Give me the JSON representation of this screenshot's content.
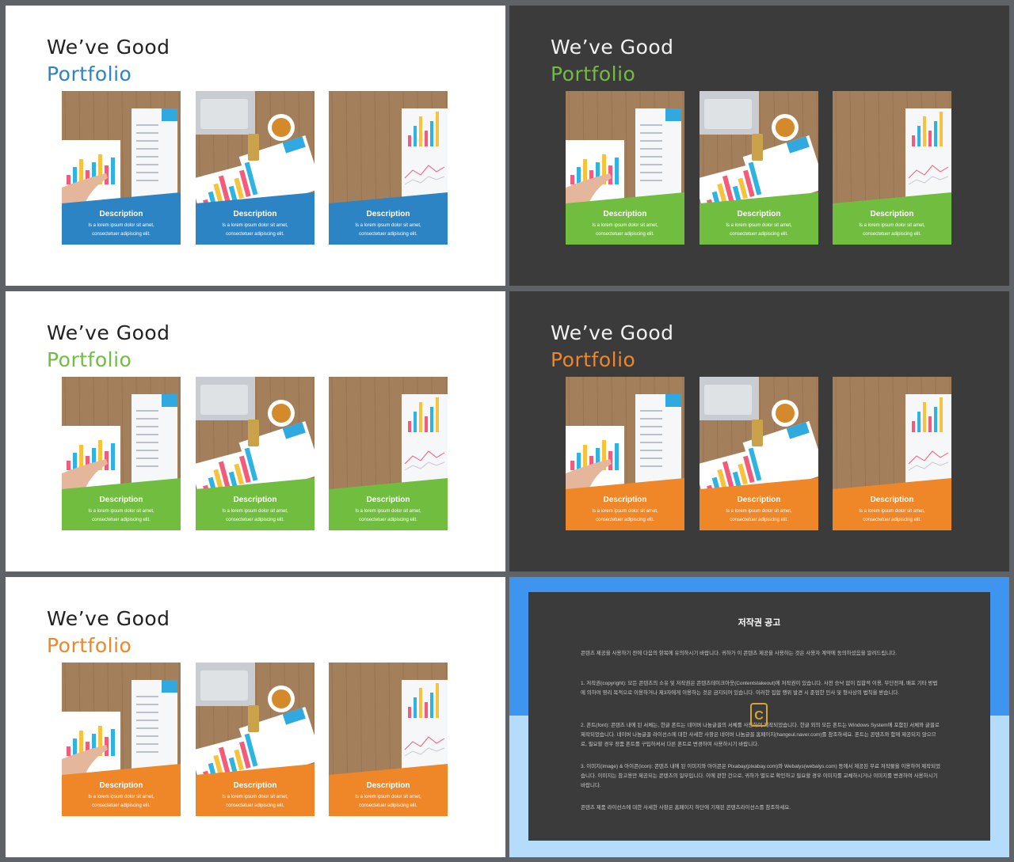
{
  "colors": {
    "blue": "#2d84c4",
    "green": "#71bd3f",
    "orange": "#ef8628",
    "dark_bg": "#3b3b3b",
    "notice_blue": "#3d95f0",
    "notice_light_blue": "#b6dcfb"
  },
  "slides": [
    {
      "theme": "light",
      "accent": "#2d84c4",
      "line1": "We’ve Good",
      "line2": "Portfolio",
      "cards": [
        {
          "title": "Description",
          "body1": "Is a lorem ipsum dolor sit amet,",
          "body2": "consectetuer adipiscing elit."
        },
        {
          "title": "Description",
          "body1": "Is a lorem ipsum dolor sit amet,",
          "body2": "consectetuer adipiscing elit."
        },
        {
          "title": "Description",
          "body1": "Is a lorem ipsum dolor sit amet,",
          "body2": "consectetuer adipiscing elit."
        }
      ]
    },
    {
      "theme": "dark",
      "accent": "#71bd3f",
      "line1": "We’ve Good",
      "line2": "Portfolio",
      "cards": [
        {
          "title": "Description",
          "body1": "Is a lorem ipsum dolor sit amet,",
          "body2": "consectetuer adipiscing elit."
        },
        {
          "title": "Description",
          "body1": "Is a lorem ipsum dolor sit amet,",
          "body2": "consectetuer adipiscing elit."
        },
        {
          "title": "Description",
          "body1": "Is a lorem ipsum dolor sit amet,",
          "body2": "consectetuer adipiscing elit."
        }
      ]
    },
    {
      "theme": "light",
      "accent": "#71bd3f",
      "line1": "We’ve Good",
      "line2": "Portfolio",
      "cards": [
        {
          "title": "Description",
          "body1": "Is a lorem ipsum dolor sit amet,",
          "body2": "consectetuer adipiscing elit."
        },
        {
          "title": "Description",
          "body1": "Is a lorem ipsum dolor sit amet,",
          "body2": "consectetuer adipiscing elit."
        },
        {
          "title": "Description",
          "body1": "Is a lorem ipsum dolor sit amet,",
          "body2": "consectetuer adipiscing elit."
        }
      ]
    },
    {
      "theme": "dark",
      "accent": "#ef8628",
      "line1": "We’ve Good",
      "line2": "Portfolio",
      "cards": [
        {
          "title": "Description",
          "body1": "Is a lorem ipsum dolor sit amet,",
          "body2": "consectetuer adipiscing elit."
        },
        {
          "title": "Description",
          "body1": "Is a lorem ipsum dolor sit amet,",
          "body2": "consectetuer adipiscing elit."
        },
        {
          "title": "Description",
          "body1": "Is a lorem ipsum dolor sit amet,",
          "body2": "consectetuer adipiscing elit."
        }
      ]
    },
    {
      "theme": "light",
      "accent": "#ef8628",
      "line1": "We’ve Good",
      "line2": "Portfolio",
      "cards": [
        {
          "title": "Description",
          "body1": "Is a lorem ipsum dolor sit amet,",
          "body2": "consectetuer adipiscing elit."
        },
        {
          "title": "Description",
          "body1": "Is a lorem ipsum dolor sit amet,",
          "body2": "consectetuer adipiscing elit."
        },
        {
          "title": "Description",
          "body1": "Is a lorem ipsum dolor sit amet,",
          "body2": "consectetuer adipiscing elit."
        }
      ]
    }
  ],
  "notice": {
    "title": "저작권 공고",
    "para0": "콘텐츠 제공을 사용하기 전에 다음의 항목에 유의하시기 바랍니다. 귀하가 이 콘텐츠 제공을 사용하는 것은 사용자 계약에 동의하셨음을 알려드립니다.",
    "para1": "1. 저작권(copyright): 모든 콘텐츠의 소유 및 저작권은 콘텐츠테이크아웃(Contentstakeout)에 저작권이 있습니다. 사전 승낙 없이 집합적 이용, 무단전재, 배포 기타 방법에 의하여 영리 목적으로 이용하거나 제3자에게 이용하는 것은 금지되어 있습니다. 이러한 집합 행위 발견 시 준엄한 민사 및 형사상의 법칙을 받습니다.",
    "para2": "2. 폰트(font): 콘텐츠 내에 된 서체는, 한글 폰트는 네이버 나눔글꼴의 서체를 사용하여 제작되었습니다. 한글 외의 모든 폰트는 Windows System에 포함된 서체와 글꼴로 제작되었습니다. 네이버 나눔글꼴 라이선스에 대한 사세한 사항은 네이버 나눔글꼴 홈페이지(hangeul.naver.com)를 참조하세요. 폰트는 콘텐츠와 함께 제공되지 않으므로, 필요할 경우 정품 폰트를 구입하셔서 다른 폰트로 변경하여 사용하시기 바랍니다.",
    "para3": "3. 이미지(image) & 아이콘(icon): 콘텐츠 내에 된 이미지와 아이콘은 Pixabay(pixabay.com)와 Webalys(webalys.com) 등에서 제공된 무료 저작물을 이용하여 제작되었습니다. 이미지는 참고용만 제공되는 콘텐츠의 일부입니다. 이에 관한 건으로, 귀하가 별도로 확인하고 필요할 경우 이미지를 교체하시거나 이미지를 변경하여 사용하시기 바랍니다.",
    "para4": "콘텐츠 제품 라이선스에 대한 사세한 사항은 홈페이지 하단에 기재된 콘텐츠라이선스를 참조하세요.",
    "logo_letter": "C"
  }
}
